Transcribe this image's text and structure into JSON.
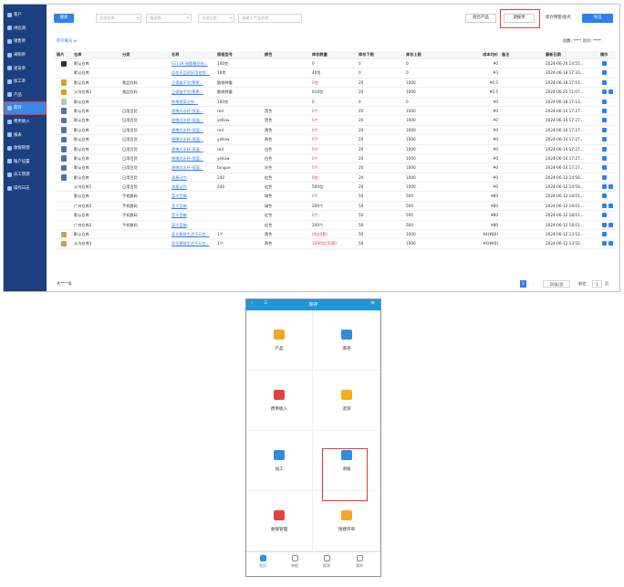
{
  "sidebar": {
    "items": [
      {
        "label": "客户",
        "icon": "user-icon"
      },
      {
        "label": "供应商",
        "icon": "supplier-icon"
      },
      {
        "label": "销售单",
        "icon": "sales-icon"
      },
      {
        "label": "采购单",
        "icon": "purchase-icon"
      },
      {
        "label": "退货单",
        "icon": "return-icon"
      },
      {
        "label": "加工单",
        "icon": "process-icon"
      },
      {
        "label": "产品",
        "icon": "product-icon"
      },
      {
        "label": "库存",
        "icon": "inventory-icon",
        "active": true
      },
      {
        "label": "费用收入",
        "icon": "expense-icon"
      },
      {
        "label": "报表",
        "icon": "report-icon"
      },
      {
        "label": "收银管理",
        "icon": "cashier-icon"
      },
      {
        "label": "账户设置",
        "icon": "account-icon"
      },
      {
        "label": "员工管理",
        "icon": "staff-icon"
      },
      {
        "label": "操作日志",
        "icon": "log-icon"
      }
    ]
  },
  "toolbar": {
    "search_label": "搜索",
    "filter1": "全部仓库",
    "filter2": "请选择",
    "filter3": "全部分类",
    "filter4": "请输入产品名称",
    "btn_combine": "组合产品",
    "btn_transfer": "调拨单",
    "btn_check": "库存预警/盘点",
    "btn_export": "导出"
  },
  "summary": {
    "link": "库存概况 ⇄",
    "total_label": "总数: ****  总价: ****"
  },
  "table": {
    "headers": [
      "图片",
      "仓库",
      "分类",
      "名称",
      "规格型号",
      "颜色",
      "库存数量",
      "库存下限",
      "库存上限",
      "成本均价",
      "备注",
      "最新日期",
      "操作"
    ],
    "rows": [
      {
        "thumb": "#333333",
        "wh": "默认仓库",
        "cat": "",
        "name": "S1118-海量最好的...",
        "spec": "140克",
        "color": "",
        "qty": "0",
        "qtyRed": false,
        "min": "0",
        "max": "0",
        "cost": "¥0",
        "note": "",
        "date": "2024-06-20 14:55...",
        "ops": 1
      },
      {
        "thumb": "",
        "wh": "默认仓库",
        "cat": "",
        "name": "佳佳乐品质好用使用...",
        "spec": "10克",
        "color": "",
        "qty": "40包",
        "qtyRed": false,
        "min": "0",
        "max": "0",
        "cost": "¥3",
        "note": "",
        "date": "2024-06-18 17:33...",
        "ops": 1
      },
      {
        "thumb": "#d8a020",
        "wh": "默认仓库",
        "cat": "食品饮料",
        "name": "王德盛干货/果果...",
        "spec": "散装称重",
        "color": "",
        "qty": "0包",
        "qtyRed": true,
        "min": "20",
        "max": "1000",
        "cost": "¥0.5",
        "note": "",
        "date": "2024-06-18 17:16...",
        "ops": 1
      },
      {
        "thumb": "#d8a020",
        "wh": "义乌仓库1",
        "cat": "食品饮料",
        "name": "王德盛干货/果果...",
        "spec": "散装称重",
        "color": "",
        "qty": "610包",
        "qtyRed": false,
        "min": "20",
        "max": "1000",
        "cost": "¥0.5",
        "note": "",
        "date": "2024-06-25 11:07...",
        "ops": 2
      },
      {
        "thumb": "#b9c9a0",
        "wh": "默认仓库",
        "cat": "",
        "name": "鲜果蔬菜分拣...",
        "spec": "100克",
        "color": "",
        "qty": "0",
        "qtyRed": false,
        "min": "0",
        "max": "0",
        "cost": "¥0",
        "note": "",
        "date": "2024-06-18 17:13...",
        "ops": 1
      },
      {
        "thumb": "#5a6fa8",
        "wh": "默认仓库",
        "cat": "日用百货",
        "name": "便携式水杯-保温...",
        "spec": "red",
        "color": "黑色",
        "qty": "0个",
        "qtyRed": true,
        "min": "20",
        "max": "1000",
        "cost": "¥0",
        "note": "",
        "date": "2024-06-14 17:27...",
        "ops": 1
      },
      {
        "thumb": "#5a6fa8",
        "wh": "默认仓库",
        "cat": "日用百货",
        "name": "便携式水杯-保温...",
        "spec": "yellow",
        "color": "黑色",
        "qty": "0个",
        "qtyRed": true,
        "min": "20",
        "max": "1000",
        "cost": "¥0",
        "note": "",
        "date": "2024-06-14 17:27...",
        "ops": 1
      },
      {
        "thumb": "#5a6fa8",
        "wh": "默认仓库",
        "cat": "日用百货",
        "name": "便携式水杯-保温...",
        "spec": "red",
        "color": "黄色",
        "qty": "0个",
        "qtyRed": true,
        "min": "20",
        "max": "1000",
        "cost": "¥0",
        "note": "",
        "date": "2024-06-14 17:27...",
        "ops": 1
      },
      {
        "thumb": "#5a6fa8",
        "wh": "默认仓库",
        "cat": "日用百货",
        "name": "便携式水杯-保温...",
        "spec": "yellow",
        "color": "黄色",
        "qty": "0个",
        "qtyRed": true,
        "min": "20",
        "max": "1000",
        "cost": "¥0",
        "note": "",
        "date": "2024-06-14 17:27...",
        "ops": 1
      },
      {
        "thumb": "#5a6fa8",
        "wh": "默认仓库",
        "cat": "日用百货",
        "name": "便携式水杯-保温...",
        "spec": "red",
        "color": "白色",
        "qty": "0个",
        "qtyRed": true,
        "min": "20",
        "max": "1000",
        "cost": "¥0",
        "note": "",
        "date": "2024-06-14 17:27...",
        "ops": 1
      },
      {
        "thumb": "#5a6fa8",
        "wh": "默认仓库",
        "cat": "日用百货",
        "name": "便携式水杯-保温...",
        "spec": "yellow",
        "color": "白色",
        "qty": "0个",
        "qtyRed": true,
        "min": "20",
        "max": "1000",
        "cost": "¥0",
        "note": "",
        "date": "2024-06-14 17:27...",
        "ops": 1
      },
      {
        "thumb": "#5a6fa8",
        "wh": "默认仓库",
        "cat": "日用百货",
        "name": "便携式水杯-保温...",
        "spec": "tongue",
        "color": "灰色",
        "qty": "0个",
        "qtyRed": true,
        "min": "20",
        "max": "1000",
        "cost": "¥0",
        "note": "",
        "date": "2024-06-14 17:27...",
        "ops": 1
      },
      {
        "thumb": "#5a6fa8",
        "wh": "默认仓库",
        "cat": "日用百货",
        "name": "流星动力",
        "spec": "240",
        "color": "红色",
        "qty": "0包",
        "qtyRed": true,
        "min": "20",
        "max": "1000",
        "cost": "¥0",
        "note": "",
        "date": "2024-06-13 14:58...",
        "ops": 1
      },
      {
        "thumb": "",
        "wh": "义乌仓库1",
        "cat": "日用百货",
        "name": "流星动力",
        "spec": "240",
        "color": "红色",
        "qty": "500包",
        "qtyRed": false,
        "min": "20",
        "max": "1000",
        "cost": "¥0",
        "note": "",
        "date": "2024-06-12 14:58...",
        "ops": 2
      },
      {
        "thumb": "",
        "wh": "默认仓库",
        "cat": "手机数码",
        "name": "蓝牙音箱",
        "spec": "",
        "color": "绿色",
        "qty": "0个",
        "qtyRed": true,
        "min": "50",
        "max": "500",
        "cost": "¥80",
        "note": "",
        "date": "2024-06-12 18:01...",
        "ops": 1
      },
      {
        "thumb": "",
        "wh": "广州仓库2",
        "cat": "手机数码",
        "name": "蓝牙音箱",
        "spec": "",
        "color": "绿色",
        "qty": "200个",
        "qtyRed": false,
        "min": "50",
        "max": "500",
        "cost": "¥80",
        "note": "",
        "date": "2024-06-12 18:01...",
        "ops": 2
      },
      {
        "thumb": "",
        "wh": "默认仓库",
        "cat": "手机数码",
        "name": "蓝牙音箱",
        "spec": "",
        "color": "红色",
        "qty": "0个",
        "qtyRed": true,
        "min": "50",
        "max": "500",
        "cost": "¥80",
        "note": "",
        "date": "2024-06-12 18:01...",
        "ops": 1
      },
      {
        "thumb": "",
        "wh": "广州仓库2",
        "cat": "手机数码",
        "name": "蓝牙音箱",
        "spec": "",
        "color": "红色",
        "qty": "200个",
        "qtyRed": false,
        "min": "50",
        "max": "500",
        "cost": "¥80",
        "note": "",
        "date": "2024-06-12 18:01...",
        "ops": 2
      },
      {
        "thumb": "#c8a050",
        "wh": "默认仓库",
        "cat": "",
        "name": "家头聚财生活千元包...",
        "spec": "1个",
        "color": "黄色",
        "qty": "0包(0套)",
        "qtyRed": true,
        "min": "50",
        "max": "1000",
        "cost": "¥4(¥80)",
        "note": "",
        "date": "2024-06-12 13:52...",
        "ops": 1
      },
      {
        "thumb": "#c8a050",
        "wh": "义乌仓库1",
        "cat": "",
        "name": "家头聚财生活千元包...",
        "spec": "1个",
        "color": "黄色",
        "qty": "1000包(50套)",
        "qtyRed": true,
        "min": "50",
        "max": "1000",
        "cost": "¥4(¥80)",
        "note": "",
        "date": "2024-06-12 13:52...",
        "ops": 2
      }
    ]
  },
  "pagination": {
    "total": "共****条",
    "page": "1",
    "page_size": "20条/页",
    "goto_label": "前往",
    "goto_value": "1",
    "goto_suffix": "页"
  },
  "mobile": {
    "title": "库存",
    "tiles": [
      {
        "label": "产品",
        "icon": "product-icon",
        "color": "#f4a52a"
      },
      {
        "label": "库存",
        "icon": "inventory-icon",
        "color": "#2e8de0"
      },
      {
        "label": "费用收入",
        "icon": "expense-icon",
        "color": "#e0433a"
      },
      {
        "label": "退货",
        "icon": "return-icon",
        "color": "#f2b01c"
      },
      {
        "label": "加工",
        "icon": "process-icon",
        "color": "#2e8de0"
      },
      {
        "label": "调拨",
        "icon": "transfer-icon",
        "color": "#2e8de0"
      },
      {
        "label": "收银管理",
        "icon": "cashier-icon",
        "color": "#e0433a"
      },
      {
        "label": "快捷开单",
        "icon": "quick-order-icon",
        "color": "#f4a52a"
      }
    ],
    "nav": [
      {
        "label": "首页",
        "active": true
      },
      {
        "label": "单据"
      },
      {
        "label": "报表"
      },
      {
        "label": "我的"
      }
    ]
  }
}
